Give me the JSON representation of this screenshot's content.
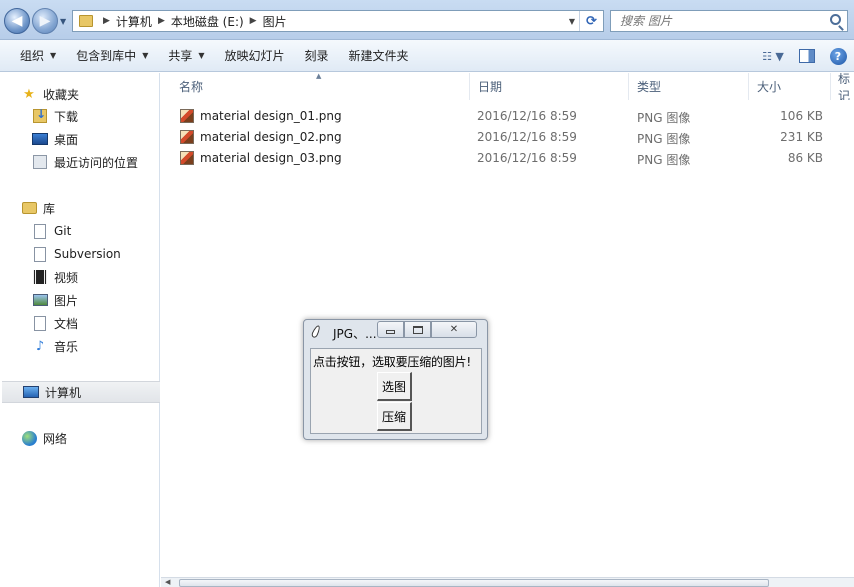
{
  "address_bar": {
    "breadcrumbs": [
      "计算机",
      "本地磁盘 (E:)",
      "图片"
    ],
    "search_placeholder": "搜索 图片"
  },
  "toolbar": {
    "organize": "组织",
    "include_in_library": "包含到库中",
    "share": "共享",
    "slideshow": "放映幻灯片",
    "burn": "刻录",
    "new_folder": "新建文件夹"
  },
  "sidebar": {
    "favorites": "收藏夹",
    "downloads": "下载",
    "desktop": "桌面",
    "recent": "最近访问的位置",
    "libraries": "库",
    "git": "Git",
    "subversion": "Subversion",
    "videos": "视频",
    "pictures": "图片",
    "documents": "文档",
    "music": "音乐",
    "computer": "计算机",
    "network": "网络"
  },
  "columns": {
    "name": "名称",
    "date": "日期",
    "type": "类型",
    "size": "大小",
    "tags": "标记"
  },
  "files": [
    {
      "name": "material design_01.png",
      "date": "2016/12/16 8:59",
      "type": "PNG 图像",
      "size": "106 KB"
    },
    {
      "name": "material design_02.png",
      "date": "2016/12/16 8:59",
      "type": "PNG 图像",
      "size": "231 KB"
    },
    {
      "name": "material design_03.png",
      "date": "2016/12/16 8:59",
      "type": "PNG 图像",
      "size": "86 KB"
    }
  ],
  "dialog": {
    "title": "JPG、...",
    "prompt": "点击按钮，选取要压缩的图片!",
    "select_button": "选图",
    "compress_button": "压缩"
  }
}
